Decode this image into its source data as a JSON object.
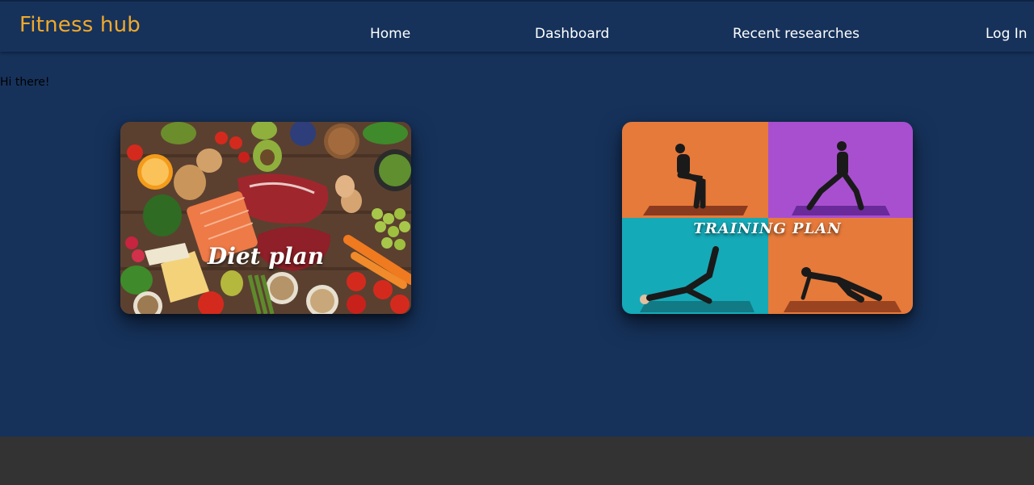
{
  "navbar": {
    "brand": "Fitness hub",
    "links": [
      "Home",
      "Dashboard",
      "Recent researches",
      "Log In"
    ]
  },
  "main": {
    "greeting": "Hi there!",
    "cards": [
      {
        "label": "Diet plan",
        "image": "food-photo"
      },
      {
        "label": "TRAINING PLAN",
        "image": "workout-photo"
      }
    ]
  },
  "colors": {
    "background": "#16325b",
    "brand": "#f0a92b",
    "footer": "#333333"
  }
}
